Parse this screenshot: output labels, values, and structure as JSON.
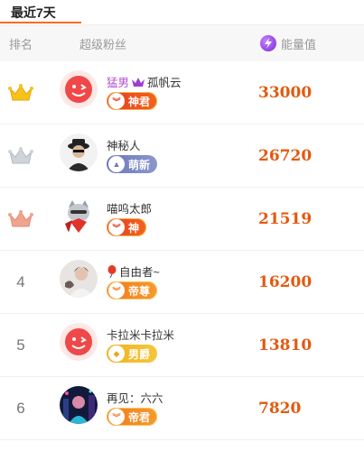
{
  "tabs": {
    "active": "最近7天"
  },
  "header": {
    "rank": "排名",
    "fans": "超级粉丝",
    "energy": "能量值"
  },
  "rows": [
    {
      "rank": "1",
      "rank_icon": "gold-crown-icon",
      "name_prefix": "猛男",
      "name_suffix": "孤帆云",
      "badge": "神君",
      "energy": "33000",
      "avatar": "red-face-avatar"
    },
    {
      "rank": "2",
      "rank_icon": "silver-crown-icon",
      "name": "神秘人",
      "badge": "萌新",
      "energy": "26720",
      "avatar": "hooded-figure-avatar"
    },
    {
      "rank": "3",
      "rank_icon": "bronze-crown-icon",
      "name": "喵呜太郎",
      "badge": "神",
      "energy": "21519",
      "avatar": "cartoon-cat-avatar"
    },
    {
      "rank": "4",
      "name": "自由者~",
      "badge": "帝尊",
      "energy": "16200",
      "avatar": "photo-avatar"
    },
    {
      "rank": "5",
      "name": "卡拉米卡拉米",
      "badge": "男爵",
      "energy": "13810",
      "avatar": "red-face-avatar"
    },
    {
      "rank": "6",
      "name": "再见：六六",
      "badge": "帝君",
      "energy": "7820",
      "avatar": "night-city-avatar"
    }
  ],
  "colors": {
    "accent": "#ff6a1a",
    "energy": "#e25a10",
    "header_bg": "#f7f7f7"
  }
}
